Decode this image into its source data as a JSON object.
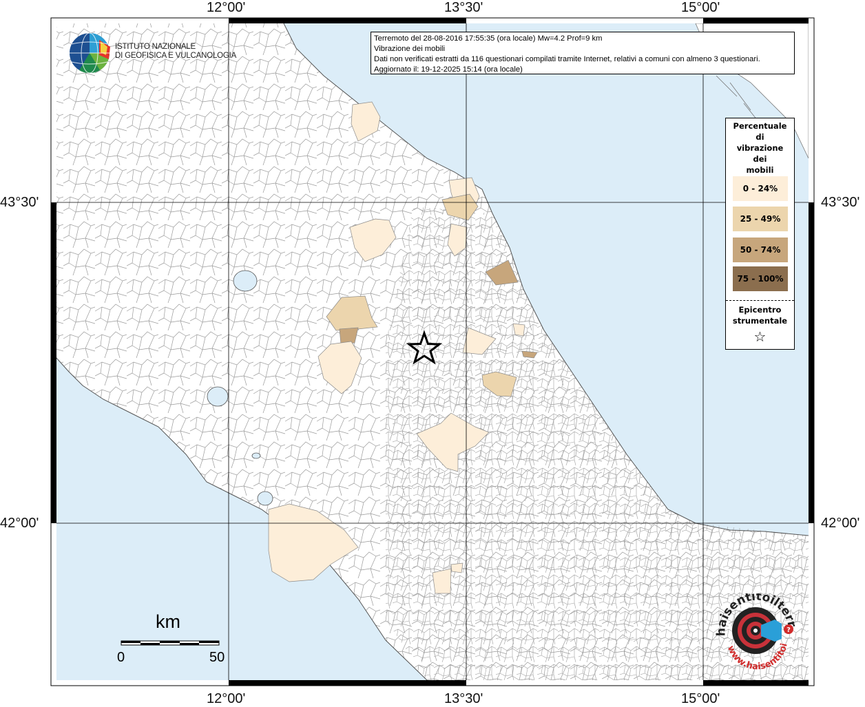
{
  "map": {
    "info": {
      "line1": "Terremoto del 28-08-2016 17:55:35 (ora locale) Mw=4.2 Prof=9 km",
      "line2": "Vibrazione dei mobili",
      "line3": "Dati non verificati estratti da 116 questionari compilati tramite Internet, relativi a comuni con almeno 3 questionari.",
      "line4": "Aggiornato il: 19-12-2025 15:14 (ora locale)"
    },
    "coordinates": {
      "top": [
        "12°00'",
        "13°30'",
        "15°00'"
      ],
      "bottom": [
        "12°00'",
        "13°30'",
        "15°00'"
      ],
      "left": [
        "43°30'",
        "42°00'"
      ],
      "right": [
        "43°30'",
        "42°00'"
      ]
    },
    "institute": {
      "line1": "ISTITUTO NAZIONALE",
      "line2": "DI GEOFISICA E VULCANOLOGIA"
    },
    "legend": {
      "title_lines": [
        "Percentuale",
        "di",
        "vibrazione",
        "dei",
        "mobili"
      ],
      "classes": [
        {
          "label": "0 - 24%",
          "color": "#fdeed9"
        },
        {
          "label": "25 - 49%",
          "color": "#ecd5ad"
        },
        {
          "label": "50 - 74%",
          "color": "#c7a67c"
        },
        {
          "label": "75 - 100%",
          "color": "#8b6e4e"
        }
      ],
      "epicenter_lines": [
        "Epicentro",
        "strumentale"
      ],
      "epicenter_symbol": "☆"
    },
    "scale": {
      "unit": "km",
      "min": "0",
      "max": "50"
    },
    "colors": {
      "sea": "#dcedf8",
      "land": "#ffffff",
      "borders": "#8a8a8a"
    },
    "watermark": {
      "text_top": "haisentitoilterremoto.it",
      "text_bottom": "www.haisentitoilterremoto.it"
    }
  }
}
